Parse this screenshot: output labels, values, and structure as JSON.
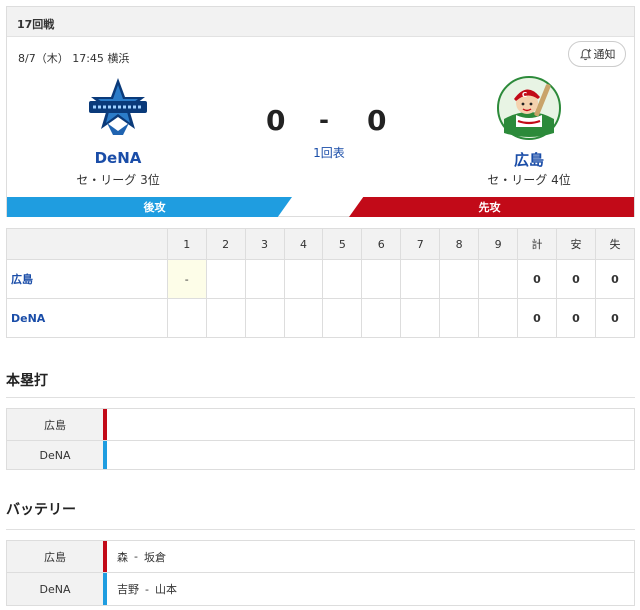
{
  "game": {
    "round_label": "17回戦",
    "datetime_venue": "8/7（木） 17:45 横浜",
    "notify_label": "通知",
    "inning_status": "1回表"
  },
  "home": {
    "name": "DeNA",
    "league_rank": "セ・リーグ 3位",
    "score": "0",
    "bar_label": "後攻",
    "color": "#1f9de0"
  },
  "away": {
    "name": "広島",
    "league_rank": "セ・リーグ 4位",
    "score": "0",
    "bar_label": "先攻",
    "color": "#c20a18"
  },
  "score_separator": "-",
  "scoreboard": {
    "innings": [
      "1",
      "2",
      "3",
      "4",
      "5",
      "6",
      "7",
      "8",
      "9"
    ],
    "totals_headers": [
      "計",
      "安",
      "失"
    ],
    "rows": [
      {
        "team": "広島",
        "innings": [
          "-",
          "",
          "",
          "",
          "",
          "",
          "",
          "",
          ""
        ],
        "totals": [
          "0",
          "0",
          "0"
        ]
      },
      {
        "team": "DeNA",
        "innings": [
          "",
          "",
          "",
          "",
          "",
          "",
          "",
          "",
          ""
        ],
        "totals": [
          "0",
          "0",
          "0"
        ]
      }
    ]
  },
  "homeruns": {
    "title": "本塁打",
    "rows": [
      {
        "team": "広島",
        "value": ""
      },
      {
        "team": "DeNA",
        "value": ""
      }
    ]
  },
  "battery": {
    "title": "バッテリー",
    "rows": [
      {
        "team": "広島",
        "pitcher": "森",
        "catcher": "坂倉",
        "sep": "-"
      },
      {
        "team": "DeNA",
        "pitcher": "吉野",
        "catcher": "山本",
        "sep": "-"
      }
    ]
  },
  "icons": {
    "notify": "bell-plus-icon",
    "home_logo": "baystars-logo",
    "away_logo": "carp-logo"
  }
}
